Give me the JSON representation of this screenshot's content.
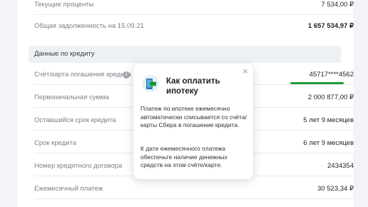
{
  "rows_top": [
    {
      "label": "Текущие проценты",
      "value": "7 534,00 ₽"
    },
    {
      "label": "Общая задолженность на 15.09.21",
      "value": "1 657 534,97 ₽"
    }
  ],
  "section_title": "Данные по кредиту",
  "rows": [
    {
      "label": "Счёт/карта погашения кредита",
      "value": "45717****4562"
    },
    {
      "label": "Первоначальная сумма",
      "value": "2 000 877,00 ₽"
    },
    {
      "label": "Оставшийся срок кредита",
      "value": "5 лет 9 месяцев"
    },
    {
      "label": "Срок кредита",
      "value": "6 лет 9 месяцев"
    },
    {
      "label": "Номер кредитного договора",
      "value": "2434354"
    },
    {
      "label": "Ежемесячный платеж",
      "value": "30 523,34 ₽"
    }
  ],
  "info_icon_glyph": "i",
  "popup": {
    "title": "Как оплатить ипотеку",
    "close_glyph": "×",
    "paragraph1": "Платеж по ипотеке ежемесячно автоматически списывается со счёта/карты Сбера в погашение кредита.",
    "paragraph2": "К дате ежемесячного платежа обеспечьте наличие денежных средств на этом счёте/карте.",
    "icon": "phone-card-icon"
  },
  "colors": {
    "accent_green": "#21a038",
    "section_bg": "#edf0f5",
    "page_bg": "#f2f4f7"
  }
}
